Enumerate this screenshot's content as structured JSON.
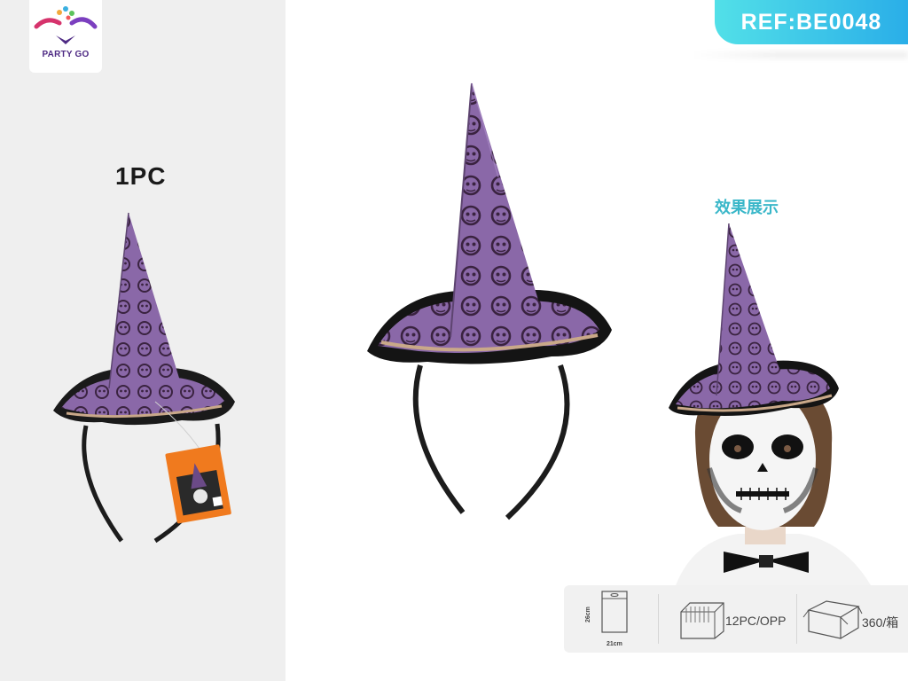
{
  "brand": {
    "logo_text": "PARTY GO"
  },
  "reference": {
    "label": "REF:BE0048"
  },
  "product": {
    "quantity_label": "1PC",
    "name_icon": "witch-hat-headband"
  },
  "demo": {
    "title": "效果展示"
  },
  "packaging": {
    "bag_height": "26cm",
    "bag_width": "21cm",
    "inner_pack": "12PC/OPP",
    "carton": "360/箱"
  },
  "colors": {
    "ref_badge_start": "#52e0e8",
    "ref_badge_end": "#2aaee8",
    "hat_purple": "#8a68a8",
    "demo_title": "#3ab7c9",
    "left_panel_bg": "#efefef"
  }
}
